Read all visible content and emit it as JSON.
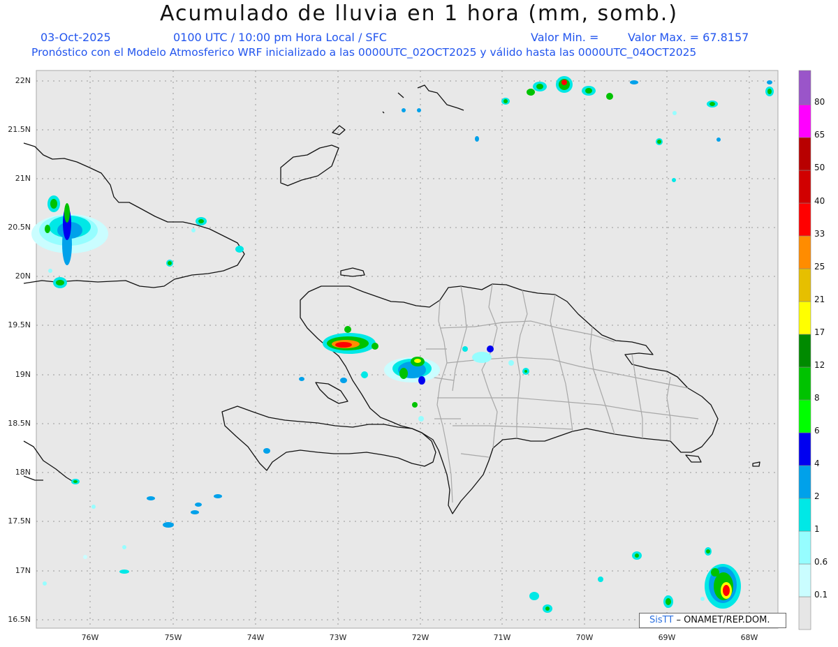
{
  "title": "Acumulado de lluvia en 1 hora (mm, somb.)",
  "header": {
    "date": "03-Oct-2025",
    "time": "0100 UTC / 10:00 pm Hora Local / SFC",
    "valor_min": "Valor Min. =",
    "valor_max": "Valor Max. = 67.8157",
    "model_line": "Pronóstico con el Modelo Atmosferico WRF inicializado a las 0000UTC_02OCT2025 y válido hasta las  0000UTC_04OCT2025"
  },
  "axes": {
    "lat_labels": [
      "22N",
      "21.5N",
      "21N",
      "20.5N",
      "20N",
      "19.5N",
      "19N",
      "18.5N",
      "18N",
      "17.5N",
      "17N",
      "16.5N"
    ],
    "lon_labels": [
      "76W",
      "75W",
      "74W",
      "73W",
      "72W",
      "71W",
      "70W",
      "69W",
      "68W"
    ]
  },
  "colorbar": {
    "labels": [
      "80",
      "65",
      "50",
      "40",
      "33",
      "25",
      "21",
      "17",
      "12",
      "8",
      "6",
      "4",
      "2",
      "1",
      "0.6",
      "0.1"
    ],
    "colors": [
      "#e6e6e6",
      "#cafdff",
      "#96fdff",
      "#00e8e6",
      "#00a1ea",
      "#0000f0",
      "#00ff00",
      "#00c200",
      "#008a00",
      "#ffff00",
      "#e6bf00",
      "#ff8c00",
      "#ff0000",
      "#d10000",
      "#b80000",
      "#ff00ff",
      "#9a55c9"
    ]
  },
  "credit": {
    "logo": "SisTT",
    "text": "– ONAMET/REP.DOM."
  }
}
